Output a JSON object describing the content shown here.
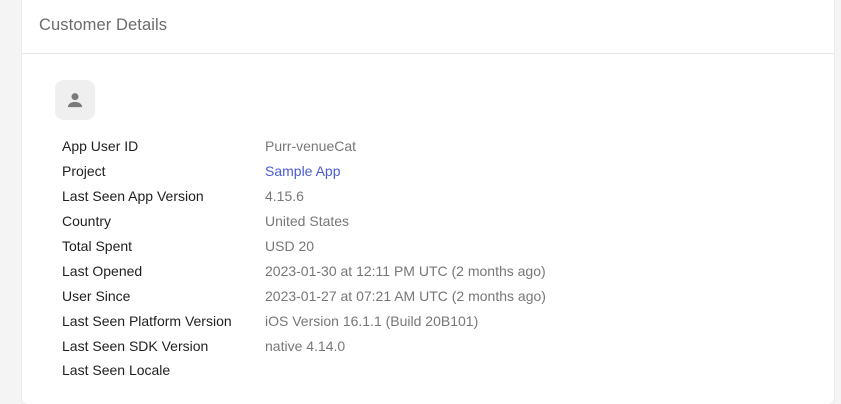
{
  "card": {
    "title": "Customer Details"
  },
  "avatar": {
    "icon": "person-icon"
  },
  "details": [
    {
      "key": "app-user-id",
      "label": "App User ID",
      "value": "Purr-venueCat",
      "link": false
    },
    {
      "key": "project",
      "label": "Project",
      "value": "Sample App",
      "link": true
    },
    {
      "key": "last-seen-app-version",
      "label": "Last Seen App Version",
      "value": "4.15.6",
      "link": false
    },
    {
      "key": "country",
      "label": "Country",
      "value": "United States",
      "link": false
    },
    {
      "key": "total-spent",
      "label": "Total Spent",
      "value": "USD 20",
      "link": false
    },
    {
      "key": "last-opened",
      "label": "Last Opened",
      "value": "2023-01-30 at 12:11 PM UTC (2 months ago)",
      "link": false
    },
    {
      "key": "user-since",
      "label": "User Since",
      "value": "2023-01-27 at 07:21 AM UTC (2 months ago)",
      "link": false
    },
    {
      "key": "last-seen-platform-version",
      "label": "Last Seen Platform Version",
      "value": "iOS Version 16.1.1 (Build 20B101)",
      "link": false
    },
    {
      "key": "last-seen-sdk-version",
      "label": "Last Seen SDK Version",
      "value": "native 4.14.0",
      "link": false
    },
    {
      "key": "last-seen-locale",
      "label": "Last Seen Locale",
      "value": "",
      "link": false
    }
  ],
  "colors": {
    "link": "#4a5bd4",
    "label": "#1f1f1f",
    "value": "#777777",
    "title": "#6b6b6b"
  }
}
